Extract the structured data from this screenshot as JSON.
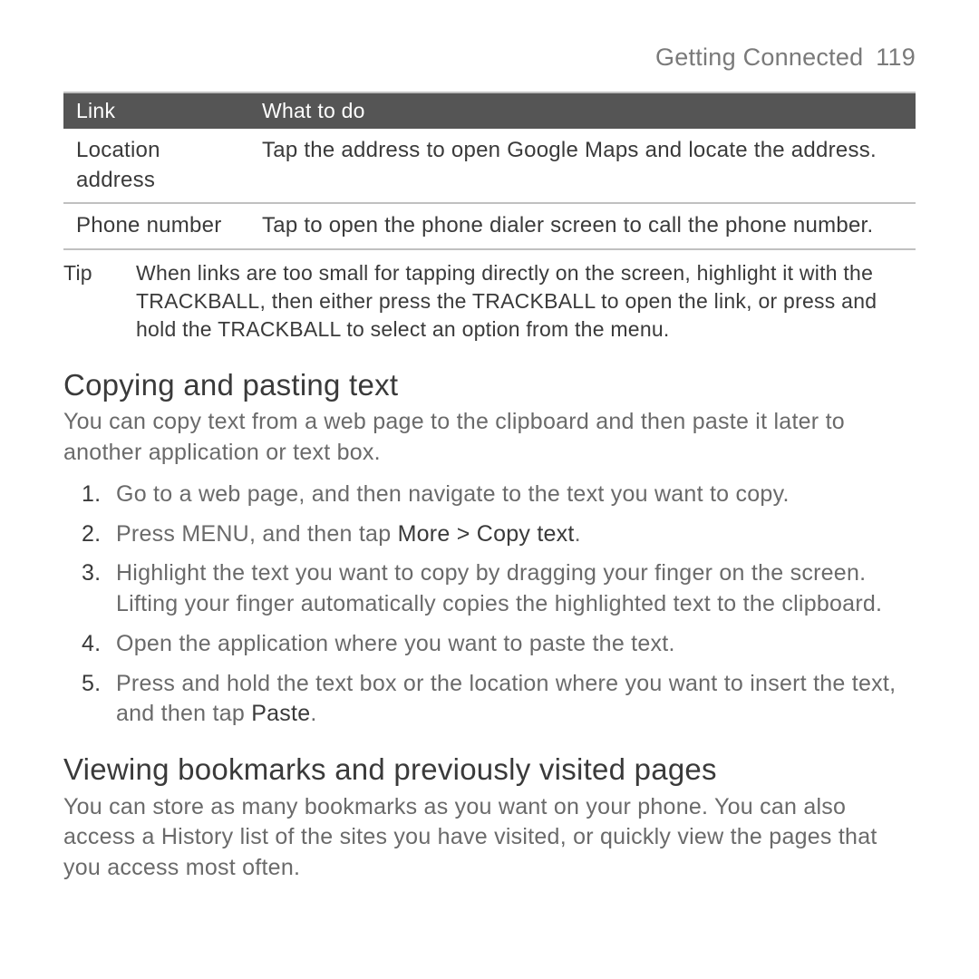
{
  "header": {
    "chapter": "Getting Connected",
    "page_number": "119"
  },
  "table": {
    "col1": "Link",
    "col2": "What to do",
    "rows": [
      {
        "link": "Location address",
        "action": "Tap the address to open Google Maps and locate the address."
      },
      {
        "link": "Phone number",
        "action": "Tap to open the phone dialer screen to call the phone number."
      }
    ]
  },
  "tip": {
    "label": "Tip",
    "body": "When links are too small for tapping directly on the screen, highlight it with the TRACKBALL, then either press the TRACKBALL to open the link, or press and hold the TRACKBALL to select an option from the menu."
  },
  "section1": {
    "title": "Copying and pasting text",
    "intro": "You can copy text from a web page to the clipboard and then paste it later to another application or text box.",
    "steps": {
      "s1": "Go to a web page, and then navigate to the text you want to copy.",
      "s2a": "Press MENU, and then tap ",
      "s2b": "More > Copy text",
      "s2c": ".",
      "s3": "Highlight the text you want to copy by dragging your finger on the screen. Lifting your finger automatically copies the highlighted text to the clipboard.",
      "s4": "Open the application where you want to paste the text.",
      "s5a": "Press and hold the text box or the location where you want to insert the text, and then tap ",
      "s5b": "Paste",
      "s5c": "."
    }
  },
  "section2": {
    "title": "Viewing bookmarks and previously visited pages",
    "intro": "You can store as many bookmarks as you want on your phone. You can also access a History list of the sites you have visited, or quickly view the pages that you access most often."
  }
}
